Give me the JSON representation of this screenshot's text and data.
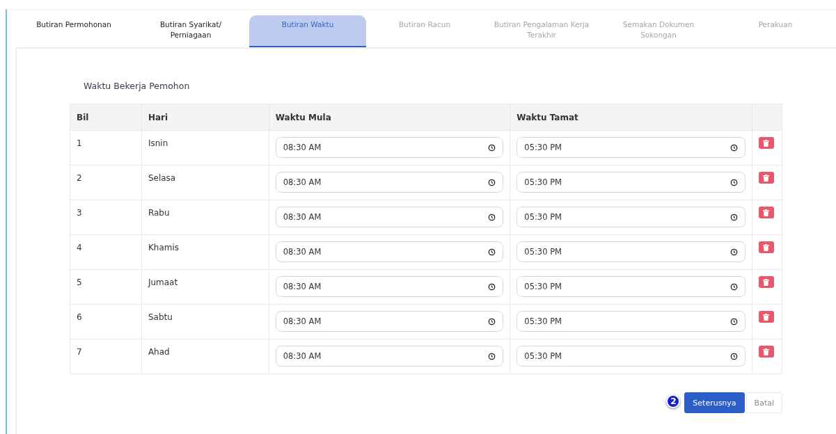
{
  "tabs": [
    {
      "label": "Butiran Permohonan",
      "selected": false,
      "disabled": false
    },
    {
      "label": "Butiran Syarikat/ Perniagaan",
      "selected": false,
      "disabled": false
    },
    {
      "label": "Butiran Waktu",
      "selected": true,
      "disabled": false
    },
    {
      "label": "Butiran Racun",
      "selected": false,
      "disabled": true
    },
    {
      "label": "Butiran Pengalaman Kerja Terakhir",
      "selected": false,
      "disabled": true
    },
    {
      "label": "Semakan Dokumen Sokongan",
      "selected": false,
      "disabled": true
    },
    {
      "label": "Perakuan",
      "selected": false,
      "disabled": true
    }
  ],
  "section_title": "Waktu Bekerja Pemohon",
  "table": {
    "columns": [
      "Bil",
      "Hari",
      "Waktu Mula",
      "Waktu Tamat"
    ],
    "rows": [
      {
        "bil": "1",
        "hari": "Isnin",
        "mula": "08:30 AM",
        "tamat": "05:30 PM"
      },
      {
        "bil": "2",
        "hari": "Selasa",
        "mula": "08:30 AM",
        "tamat": "05:30 PM"
      },
      {
        "bil": "3",
        "hari": "Rabu",
        "mula": "08:30 AM",
        "tamat": "05:30 PM"
      },
      {
        "bil": "4",
        "hari": "Khamis",
        "mula": "08:30 AM",
        "tamat": "05:30 PM"
      },
      {
        "bil": "5",
        "hari": "Jumaat",
        "mula": "08:30 AM",
        "tamat": "05:30 PM"
      },
      {
        "bil": "6",
        "hari": "Sabtu",
        "mula": "08:30 AM",
        "tamat": "05:30 PM"
      },
      {
        "bil": "7",
        "hari": "Ahad",
        "mula": "08:30 AM",
        "tamat": "05:30 PM"
      }
    ]
  },
  "step_badge": "2",
  "buttons": [
    {
      "label": "Seterusnya",
      "kind": "primary"
    },
    {
      "label": "Batal",
      "kind": "secondary"
    }
  ]
}
